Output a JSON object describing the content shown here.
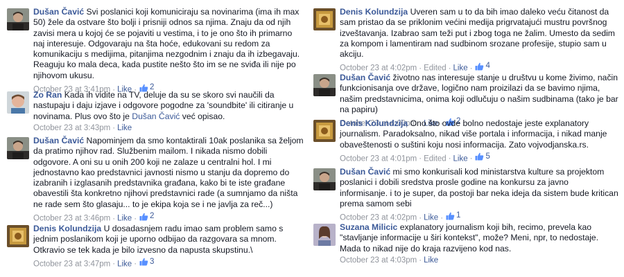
{
  "left": [
    {
      "author": "Dušan Čavić",
      "avatar": "dusan",
      "text": "Svi poslanici koji komuniciraju sa novinarima (ima ih max 50) žele da ostvare što bolji i prisniji odnos sa njima. Znaju da od njih zavisi mera u kojoj će se pojaviti u vestima, i to je ono što ih primarno naj interesuje. Odgovaraju na šta hoće, edukovani su redom za komunikaciju s medijima, pitanjima nezgodnim i znaju da ih izbegavaju. Reaguju ko mala deca, kada pustite nešto što im se ne sviđa ili nije po njihovom ukusu.",
      "time": "October 23 at 3:41pm",
      "like_label": "Like",
      "likes": "2"
    },
    {
      "author": "Zo Ran",
      "avatar": "zoran",
      "text": "Kada ih vidite na TV, deluje da su se skoro svi naučili da nastupaju i daju izjave i odgovore pogodne za 'soundbite' ili citiranje u novinama. Plus ovo što je",
      "mention": "Dušan Čavić",
      "text_after": "već opisao.",
      "time": "October 23 at 3:43pm",
      "like_label": "Like"
    },
    {
      "author": "Dušan Čavić",
      "avatar": "dusan",
      "text": "Napominjem da smo kontaktirali 10ak poslanika sa željom da pratimo njihov rad. Službenim mailom. I nikada nismo dobili odgovore. A oni su u onih 200 koji ne zalaze u centralni hol. I mi jednostavno kao predstavnici javnosti nismo u stanju da dopremo do izabranih i izglasanih predstavnika građana, kako bi te iste građane obavestili šta konkretno njihovi predstavnici rade (a sumnjamo da ništa ne rade sem što glasaju... to je ekipa koja se i ne javlja za reč...)",
      "time": "October 23 at 3:46pm",
      "like_label": "Like",
      "likes": "2"
    },
    {
      "author": "Denis Kolundzija",
      "avatar": "denis",
      "text": "U dosadasnjem radu imao sam problem samo s jednim poslanikom koji je uporno odbijao da razgovara sa mnom. Otkravio se tek kada je bilo izvesno da napusta skupstinu.\\",
      "time": "October 23 at 3:47pm",
      "like_label": "Like",
      "likes": "3"
    }
  ],
  "right": [
    {
      "author": "Denis Kolundzija",
      "avatar": "denis",
      "text": "Uveren sam u to da bih imao daleko veću čitanost da sam pristao da se priklonim većini medija prigrvatajući mustru površnog izveštavanja. Izabrao sam teži put i zbog toga ne žalim. Umesto da sedim za kompom i lamentiram nad sudbinom srozane profesije, stupio sam u akciju.",
      "time": "October 23 at 4:02pm",
      "edited": "Edited",
      "like_label": "Like",
      "likes": "4"
    },
    {
      "author": "Dušan Čavić",
      "avatar": "dusan",
      "text": "životno nas interesuje stanje u društvu u kome živimo, način funkcionisanja ove države, logično nam proizilazi da se bavimo njima, našim predstavnicima, onima koji odlučuju o našim sudbinama (tako je bar na papiru)",
      "time": "October 23 at 4:00pm",
      "like_label": "Like",
      "likes": "2"
    },
    {
      "author": "Denis Kolundzija",
      "avatar": "denis",
      "text": "Ono što ovde bolno nedostaje jeste explanatory journalism. Paradoksalno, nikad više portala i informacija, i nikad manje obaveštenosti o suštini koju nosi informacija. Zato vojvodjanska.rs.",
      "time": "October 23 at 4:01pm",
      "edited": "Edited",
      "like_label": "Like",
      "likes": "5"
    },
    {
      "author": "Dušan Čavić",
      "avatar": "dusan",
      "text": "mi smo konkurisali kod ministarstva kulture sa projektom poslanici i dobili sredstva prosle godine na konkursu za javno informisanje. i to je super, da postoji bar neka ideja da sistem bude kritican prema samom sebi",
      "time": "October 23 at 4:02pm",
      "like_label": "Like",
      "likes": "1"
    },
    {
      "author": "Suzana Milicic",
      "avatar": "suzana",
      "text": "explanatory journalism koji bih, recimo, prevela kao \"stavljanje informacije u širi kontekst\", može? Meni, npr, to nedostaje. Mada to nikad nije do kraja razvijeno kod nas.",
      "time": "October 23 at 4:03pm",
      "like_label": "Like"
    }
  ]
}
